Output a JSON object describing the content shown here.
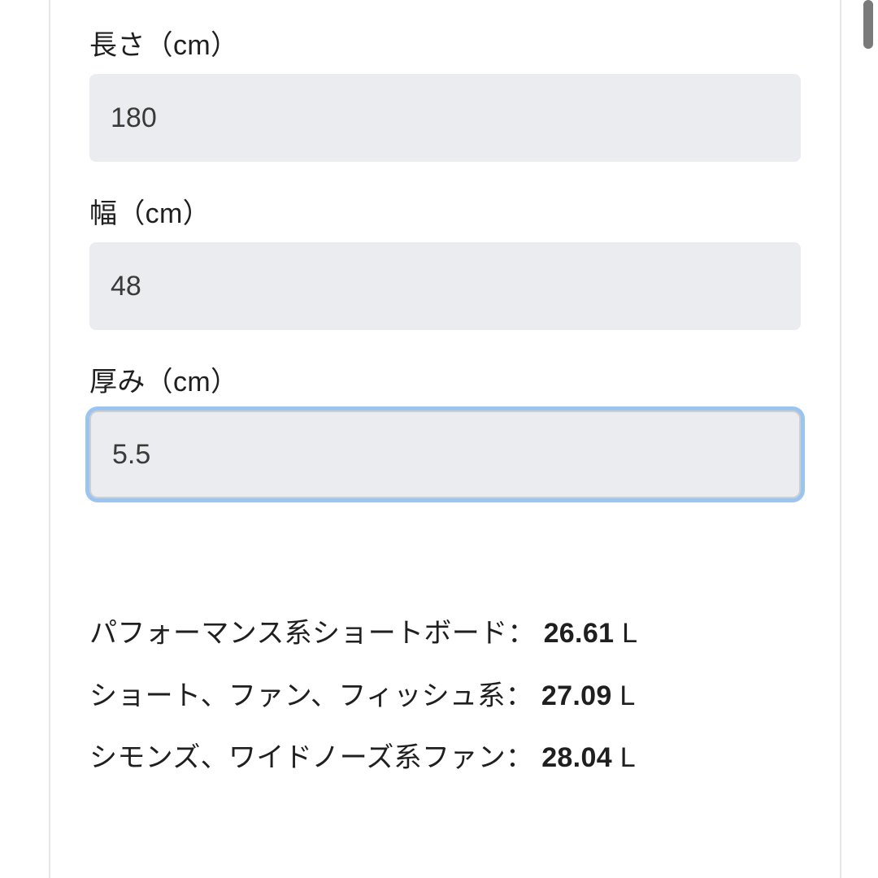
{
  "fields": {
    "length": {
      "label": "長さ（cm）",
      "value": "180"
    },
    "width": {
      "label": "幅（cm）",
      "value": "48"
    },
    "thickness": {
      "label": "厚み（cm）",
      "value": "5.5"
    }
  },
  "results": {
    "performance": {
      "label": "パフォーマンス系ショートボード：",
      "value": "26.61",
      "unit": " L"
    },
    "short_fun_fish": {
      "label": "ショート、ファン、フィッシュ系：",
      "value": "27.09",
      "unit": " L"
    },
    "simmons_wide": {
      "label": "シモンズ、ワイドノーズ系ファン：",
      "value": "28.04",
      "unit": " L"
    }
  }
}
